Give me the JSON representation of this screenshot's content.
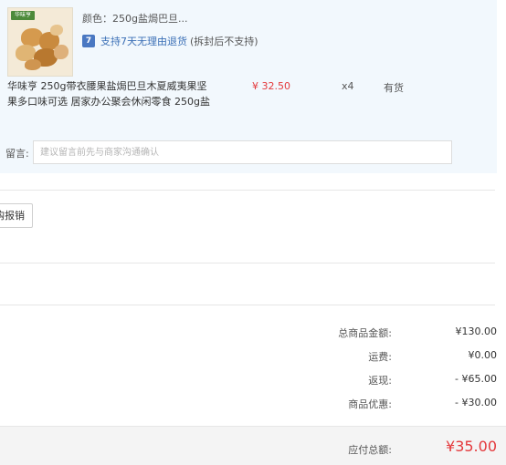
{
  "item": {
    "attr": "颜色：250g盐焗巴旦...",
    "return_badge": "7",
    "return_policy": "支持7天无理由退货",
    "return_condition": "(拆封后不支持)",
    "name": "华味亨 250g带衣腰果盐焗巴旦木夏威夷果坚果多口味可选 居家办公聚会休闲零食 250g盐",
    "price": "¥ 32.50",
    "qty": "x4",
    "stock": "有货",
    "thumb_brand": "华味亨"
  },
  "message": {
    "label": "留言:",
    "placeholder": "建议留言前先与商家沟通确认",
    "value": ""
  },
  "reimburse_button": "购报销",
  "summary": [
    {
      "label": "总商品金额:",
      "value": "¥130.00"
    },
    {
      "label": "运费:",
      "value": "¥0.00"
    },
    {
      "label": "返现:",
      "value": "- ¥65.00"
    },
    {
      "label": "商品优惠:",
      "value": "- ¥30.00"
    }
  ],
  "total": {
    "label": "应付总额:",
    "value": "¥35.00"
  },
  "colors": {
    "accent": "#e4393c",
    "panel": "#f2f8fd",
    "link": "#3b6fb6"
  }
}
